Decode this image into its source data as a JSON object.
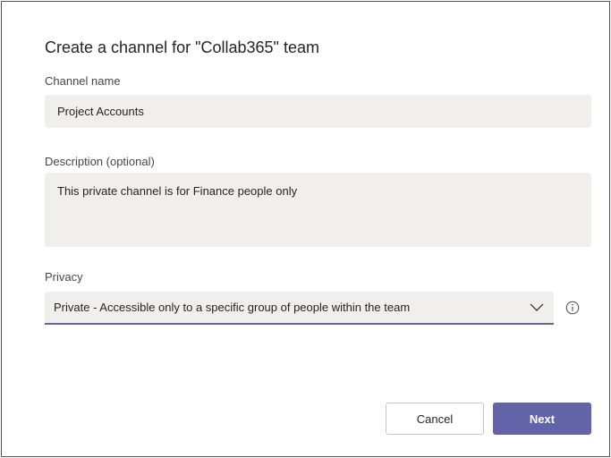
{
  "dialog": {
    "title": "Create a channel for \"Collab365\" team"
  },
  "channel_name": {
    "label": "Channel name",
    "value": "Project Accounts"
  },
  "description": {
    "label": "Description (optional)",
    "value": "This private channel is for Finance people only"
  },
  "privacy": {
    "label": "Privacy",
    "selected": "Private - Accessible only to a specific group of people within the team"
  },
  "icons": {
    "dropdown": "chevron-down-icon",
    "info": "info-icon"
  },
  "buttons": {
    "cancel_label": "Cancel",
    "next_label": "Next"
  },
  "colors": {
    "accent": "#6264a7",
    "field_background": "#f0efee",
    "text": "#252424"
  }
}
